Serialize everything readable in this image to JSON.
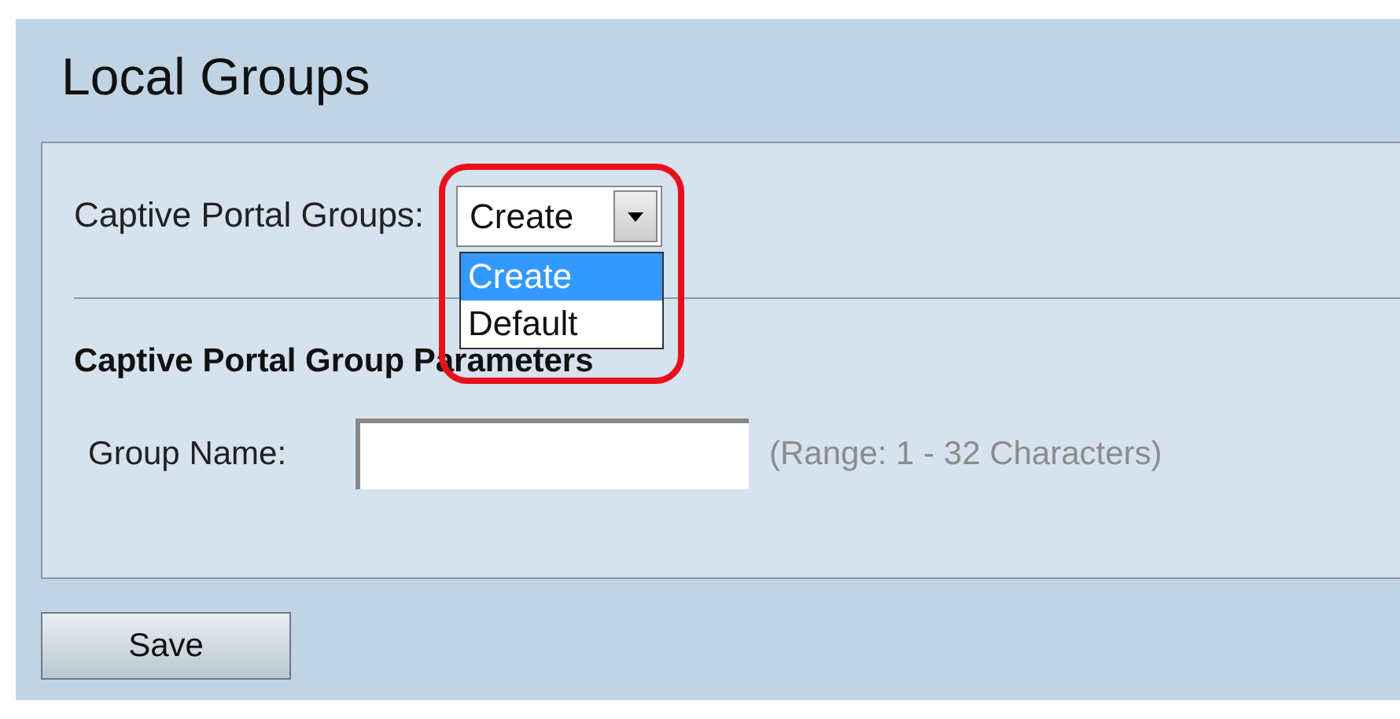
{
  "page_title": "Local Groups",
  "captive_portal_groups": {
    "label": "Captive Portal Groups:",
    "value": "Create",
    "expanded": true,
    "options": [
      {
        "label": "Create",
        "selected": true
      },
      {
        "label": "Default",
        "selected": false
      }
    ],
    "highlighted": true
  },
  "parameters": {
    "heading": "Captive Portal Group Parameters",
    "group_name": {
      "label": "Group Name:",
      "hint": "(Range: 1 - 32 Characters)"
    }
  },
  "buttons": [
    {
      "label": "Save"
    }
  ]
}
